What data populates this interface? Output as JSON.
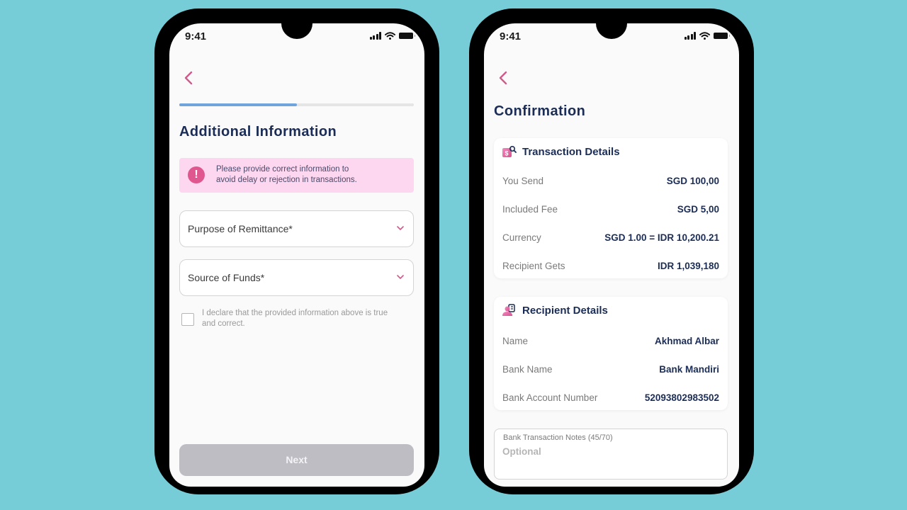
{
  "colors": {
    "background": "#76cdd7",
    "accent_pink": "#e0578f",
    "title_navy": "#1b2d56",
    "progress_blue": "#6fa5dc",
    "alert_bg": "#fdd6f0",
    "disabled_button": "#bdbdc3"
  },
  "left_screen": {
    "status_bar": {
      "time": "9:41",
      "icons": [
        "signal-icon",
        "wifi-icon",
        "battery-icon"
      ]
    },
    "back_icon": "chevron-left-icon",
    "progress": {
      "value": 0.5
    },
    "title": "Additional Information",
    "alert": {
      "icon": "exclamation-icon",
      "line1": "Please provide correct information to",
      "line2": "avoid delay or rejection in transactions."
    },
    "fields": [
      {
        "label": "Purpose of Remittance*",
        "icon": "chevron-down-icon"
      },
      {
        "label": "Source of Funds*",
        "icon": "chevron-down-icon"
      }
    ],
    "declaration": {
      "checked": false,
      "line1": "I declare that the provided information above is true",
      "line2": "and correct."
    },
    "next_button": {
      "label": "Next",
      "enabled": false
    }
  },
  "right_screen": {
    "status_bar": {
      "time": "9:41",
      "icons": [
        "signal-icon",
        "wifi-icon",
        "battery-icon"
      ]
    },
    "back_icon": "chevron-left-icon",
    "title": "Confirmation",
    "transaction_details": {
      "title": "Transaction Details",
      "icon": "money-search-icon",
      "rows": [
        {
          "label": "You Send",
          "value": "SGD 100,00"
        },
        {
          "label": "Included Fee",
          "value": "SGD 5,00"
        },
        {
          "label": "Currency",
          "value": "SGD 1.00 = IDR 10,200.21"
        },
        {
          "label": "Recipient Gets",
          "value": "IDR 1,039,180"
        }
      ]
    },
    "recipient_details": {
      "title": "Recipient Details",
      "icon": "user-card-icon",
      "rows": [
        {
          "label": "Name",
          "value": "Akhmad Albar"
        },
        {
          "label": "Bank Name",
          "value": "Bank Mandiri"
        },
        {
          "label": "Bank Account Number",
          "value": "52093802983502"
        }
      ]
    },
    "notes": {
      "label": "Bank Transaction Notes (45/70)",
      "placeholder": "Optional",
      "value": ""
    }
  }
}
